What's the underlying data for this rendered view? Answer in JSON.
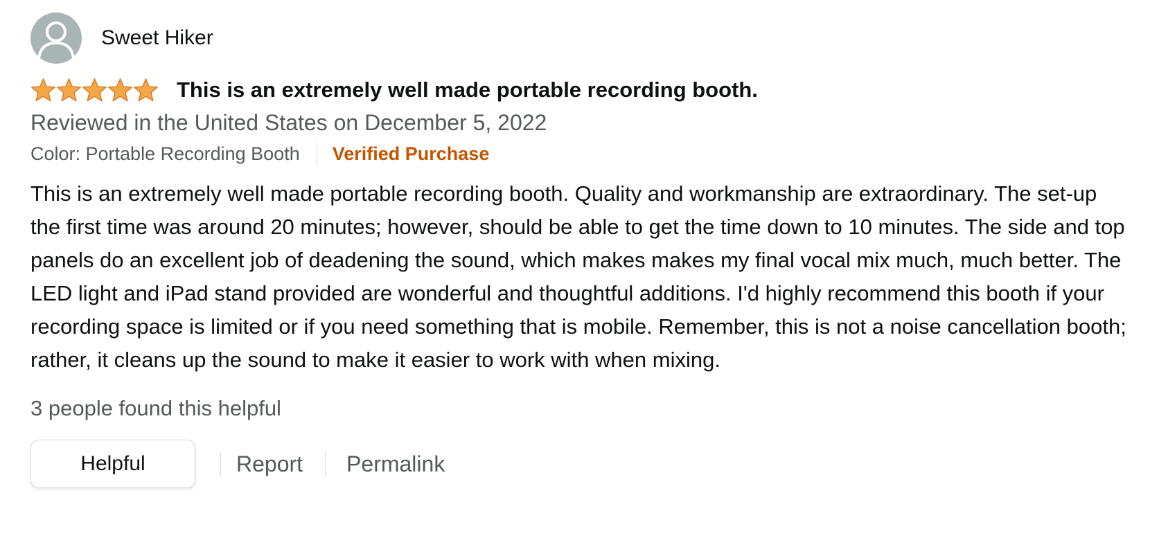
{
  "review": {
    "profile": {
      "name": "Sweet Hiker",
      "avatar_icon": "default-user-avatar"
    },
    "rating": {
      "stars": 5,
      "max_stars": 5,
      "star_color": "#f3a847",
      "star_outline_color": "#de7921"
    },
    "title": "This is an extremely well made portable recording booth.",
    "date_line": "Reviewed in the United States on December 5, 2022",
    "format_strip": "Color: Portable Recording Booth",
    "verified_label": "Verified Purchase",
    "body": "This is an extremely well made portable recording booth. Quality and workmanship are extraordinary. The set-up the first time was around 20 minutes; however, should be able to get the time down to 10 minutes. The side and top panels do an excellent job of deadening the sound, which makes makes my final vocal mix much, much better. The LED light and iPad stand provided are wonderful and thoughtful additions. I'd highly recommend this booth if your recording space is limited or if you need something that is mobile. Remember, this is not a noise cancellation booth; rather, it cleans up the sound to make it easier to work with when mixing.",
    "helpful_count": "3 people found this helpful",
    "actions": {
      "helpful_label": "Helpful",
      "report_label": "Report",
      "permalink_label": "Permalink"
    }
  },
  "colors": {
    "text_primary": "#0f1111",
    "text_secondary": "#565959",
    "verified": "#c45500",
    "divider": "#d5d9d9",
    "avatar_bg": "#a9b5b4"
  }
}
